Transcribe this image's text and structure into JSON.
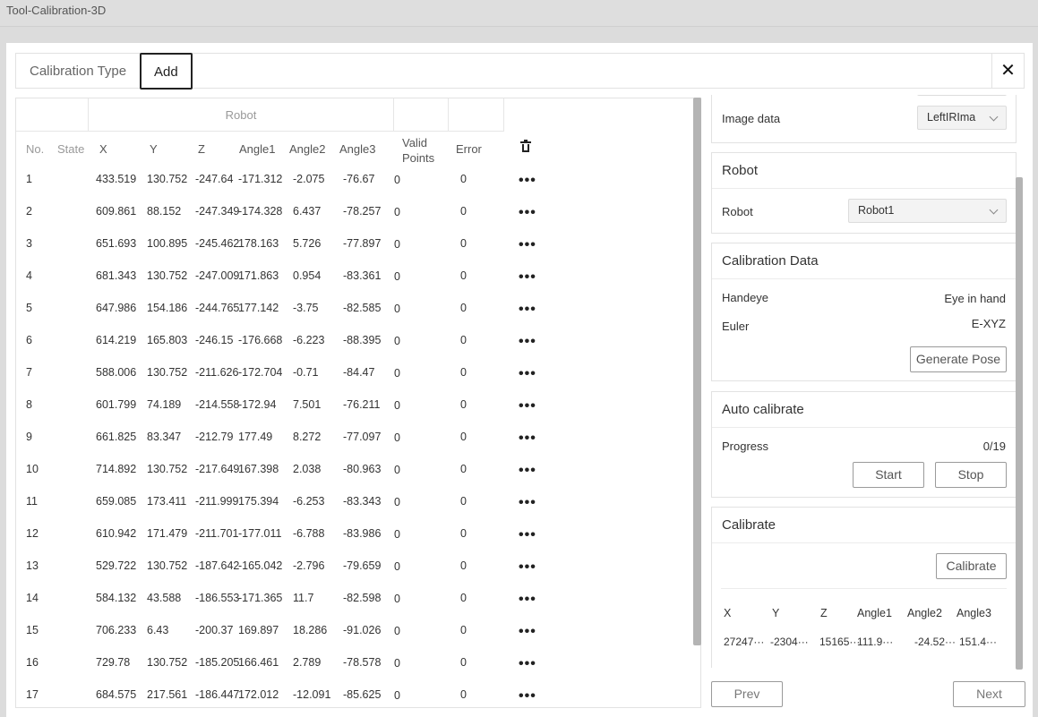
{
  "window": {
    "title": "Tool-Calibration-3D"
  },
  "tabs": [
    {
      "label": "Calibration Type"
    },
    {
      "label": "Add"
    }
  ],
  "close_label": "✕",
  "table": {
    "group_header": "Robot",
    "headers": {
      "no": "No.",
      "state": "State",
      "x": "X",
      "y": "Y",
      "z": "Z",
      "angle1": "Angle1",
      "angle2": "Angle2",
      "angle3": "Angle3",
      "valid_points_1": "Valid",
      "valid_points_2": "Points",
      "error": "Error"
    },
    "rows": [
      {
        "no": "1",
        "x": "433.519",
        "y": "130.752",
        "z": "-247.64",
        "a1": "-171.312",
        "a2": "-2.075",
        "a3": "-76.67",
        "valid": "0",
        "error": "0"
      },
      {
        "no": "2",
        "x": "609.861",
        "y": "88.152",
        "z": "-247.349",
        "a1": "-174.328",
        "a2": "6.437",
        "a3": "-78.257",
        "valid": "0",
        "error": "0"
      },
      {
        "no": "3",
        "x": "651.693",
        "y": "100.895",
        "z": "-245.462",
        "a1": "178.163",
        "a2": "5.726",
        "a3": "-77.897",
        "valid": "0",
        "error": "0"
      },
      {
        "no": "4",
        "x": "681.343",
        "y": "130.752",
        "z": "-247.009",
        "a1": "171.863",
        "a2": "0.954",
        "a3": "-83.361",
        "valid": "0",
        "error": "0"
      },
      {
        "no": "5",
        "x": "647.986",
        "y": "154.186",
        "z": "-244.765",
        "a1": "177.142",
        "a2": "-3.75",
        "a3": "-82.585",
        "valid": "0",
        "error": "0"
      },
      {
        "no": "6",
        "x": "614.219",
        "y": "165.803",
        "z": "-246.15",
        "a1": "-176.668",
        "a2": "-6.223",
        "a3": "-88.395",
        "valid": "0",
        "error": "0"
      },
      {
        "no": "7",
        "x": "588.006",
        "y": "130.752",
        "z": "-211.626",
        "a1": "-172.704",
        "a2": "-0.71",
        "a3": "-84.47",
        "valid": "0",
        "error": "0"
      },
      {
        "no": "8",
        "x": "601.799",
        "y": "74.189",
        "z": "-214.558",
        "a1": "-172.94",
        "a2": "7.501",
        "a3": "-76.211",
        "valid": "0",
        "error": "0"
      },
      {
        "no": "9",
        "x": "661.825",
        "y": "83.347",
        "z": "-212.79",
        "a1": "177.49",
        "a2": "8.272",
        "a3": "-77.097",
        "valid": "0",
        "error": "0"
      },
      {
        "no": "10",
        "x": "714.892",
        "y": "130.752",
        "z": "-217.649",
        "a1": "167.398",
        "a2": "2.038",
        "a3": "-80.963",
        "valid": "0",
        "error": "0"
      },
      {
        "no": "11",
        "x": "659.085",
        "y": "173.411",
        "z": "-211.999",
        "a1": "175.394",
        "a2": "-6.253",
        "a3": "-83.343",
        "valid": "0",
        "error": "0"
      },
      {
        "no": "12",
        "x": "610.942",
        "y": "171.479",
        "z": "-211.701",
        "a1": "-177.011",
        "a2": "-6.788",
        "a3": "-83.986",
        "valid": "0",
        "error": "0"
      },
      {
        "no": "13",
        "x": "529.722",
        "y": "130.752",
        "z": "-187.642",
        "a1": "-165.042",
        "a2": "-2.796",
        "a3": "-79.659",
        "valid": "0",
        "error": "0"
      },
      {
        "no": "14",
        "x": "584.132",
        "y": "43.588",
        "z": "-186.553",
        "a1": "-171.365",
        "a2": "11.7",
        "a3": "-82.598",
        "valid": "0",
        "error": "0"
      },
      {
        "no": "15",
        "x": "706.233",
        "y": "6.43",
        "z": "-200.37",
        "a1": "169.897",
        "a2": "18.286",
        "a3": "-91.026",
        "valid": "0",
        "error": "0"
      },
      {
        "no": "16",
        "x": "729.78",
        "y": "130.752",
        "z": "-185.205",
        "a1": "166.461",
        "a2": "2.789",
        "a3": "-78.578",
        "valid": "0",
        "error": "0"
      },
      {
        "no": "17",
        "x": "684.575",
        "y": "217.561",
        "z": "-186.447",
        "a1": "172.012",
        "a2": "-12.091",
        "a3": "-85.625",
        "valid": "0",
        "error": "0"
      }
    ],
    "row_menu_label": "•••"
  },
  "panel": {
    "image": {
      "label": "Image data",
      "value": "LeftIRIma"
    },
    "robot": {
      "title": "Robot",
      "label": "Robot",
      "value": "Robot1"
    },
    "calibration_data": {
      "title": "Calibration Data",
      "handeye_label": "Handeye",
      "handeye_value": "Eye in hand",
      "euler_label": "Euler",
      "euler_value": "E-XYZ",
      "generate_label": "Generate Pose"
    },
    "auto": {
      "title": "Auto calibrate",
      "progress_label": "Progress",
      "progress_value": "0/19",
      "start_label": "Start",
      "stop_label": "Stop"
    },
    "calibrate": {
      "title": "Calibrate",
      "button_label": "Calibrate",
      "headers": [
        "X",
        "Y",
        "Z",
        "Angle1",
        "Angle2",
        "Angle3"
      ],
      "values": [
        "27247···",
        "-2304···",
        "15165···",
        "111.9···",
        "-24.52···",
        "151.4···"
      ]
    }
  },
  "footer": {
    "prev_label": "Prev",
    "next_label": "Next"
  }
}
